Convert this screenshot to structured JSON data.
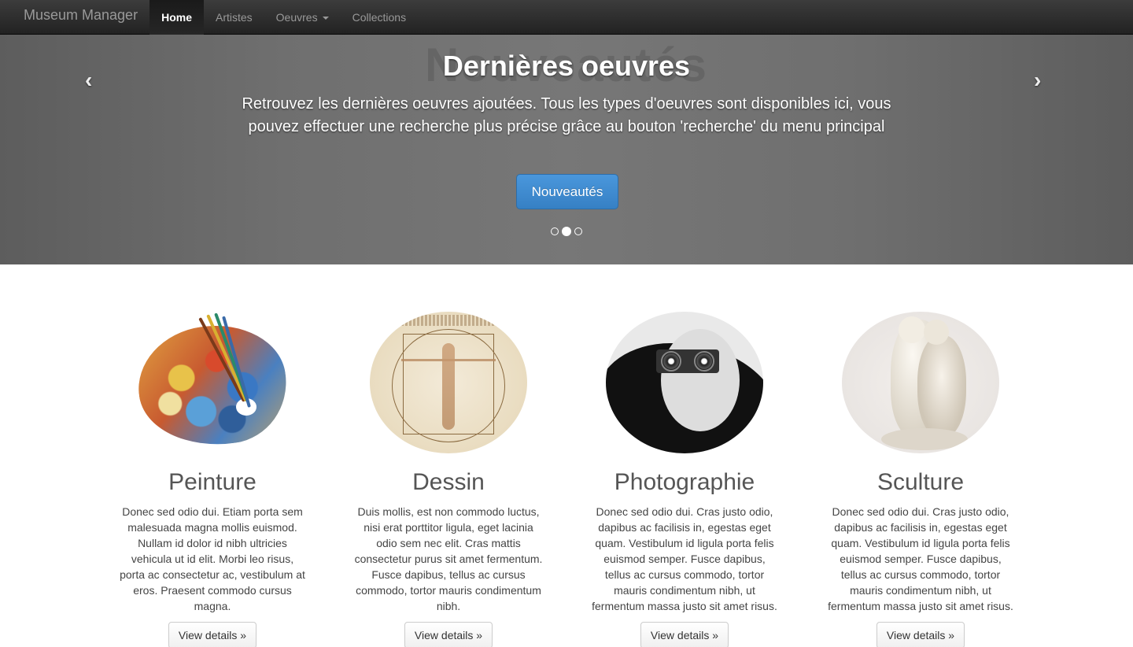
{
  "navbar": {
    "brand": "Museum Manager",
    "items": [
      {
        "label": "Home",
        "active": true
      },
      {
        "label": "Artistes",
        "active": false
      },
      {
        "label": "Oeuvres",
        "active": false,
        "dropdown": true
      },
      {
        "label": "Collections",
        "active": false
      }
    ]
  },
  "carousel": {
    "ghost_title": "Nouveautés",
    "title": "Dernières oeuvres",
    "text": "Retrouvez les dernières oeuvres ajoutées. Tous les types d'oeuvres sont disponibles ici, vous pouvez effectuer une recherche plus précise grâce au bouton 'recherche' du menu principal",
    "button_label": "Nouveautés",
    "prev_icon": "‹",
    "next_icon": "›",
    "indicators": 3,
    "active_indicator": 1
  },
  "features": [
    {
      "title": "Peinture",
      "text": "Donec sed odio dui. Etiam porta sem malesuada magna mollis euismod. Nullam id dolor id nibh ultricies vehicula ut id elit. Morbi leo risus, porta ac consectetur ac, vestibulum at eros. Praesent commodo cursus magna.",
      "button": "View details »",
      "image": "paint-palette-image"
    },
    {
      "title": "Dessin",
      "text": "Duis mollis, est non commodo luctus, nisi erat porttitor ligula, eget lacinia odio sem nec elit. Cras mattis consectetur purus sit amet fermentum. Fusce dapibus, tellus ac cursus commodo, tortor mauris condimentum nibh.",
      "button": "View details »",
      "image": "vitruvian-man-image"
    },
    {
      "title": "Photographie",
      "text": "Donec sed odio dui. Cras justo odio, dapibus ac facilisis in, egestas eget quam. Vestibulum id ligula porta felis euismod semper. Fusce dapibus, tellus ac cursus commodo, tortor mauris condimentum nibh, ut fermentum massa justo sit amet risus.",
      "button": "View details »",
      "image": "photographer-image"
    },
    {
      "title": "Sculture",
      "text": "Donec sed odio dui. Cras justo odio, dapibus ac facilisis in, egestas eget quam. Vestibulum id ligula porta felis euismod semper. Fusce dapibus, tellus ac cursus commodo, tortor mauris condimentum nibh, ut fermentum massa justo sit amet risus.",
      "button": "View details »",
      "image": "sculpture-image"
    }
  ],
  "colors": {
    "navbar": "#222222",
    "primary": "#428bca",
    "carousel_bg": "#777777"
  }
}
